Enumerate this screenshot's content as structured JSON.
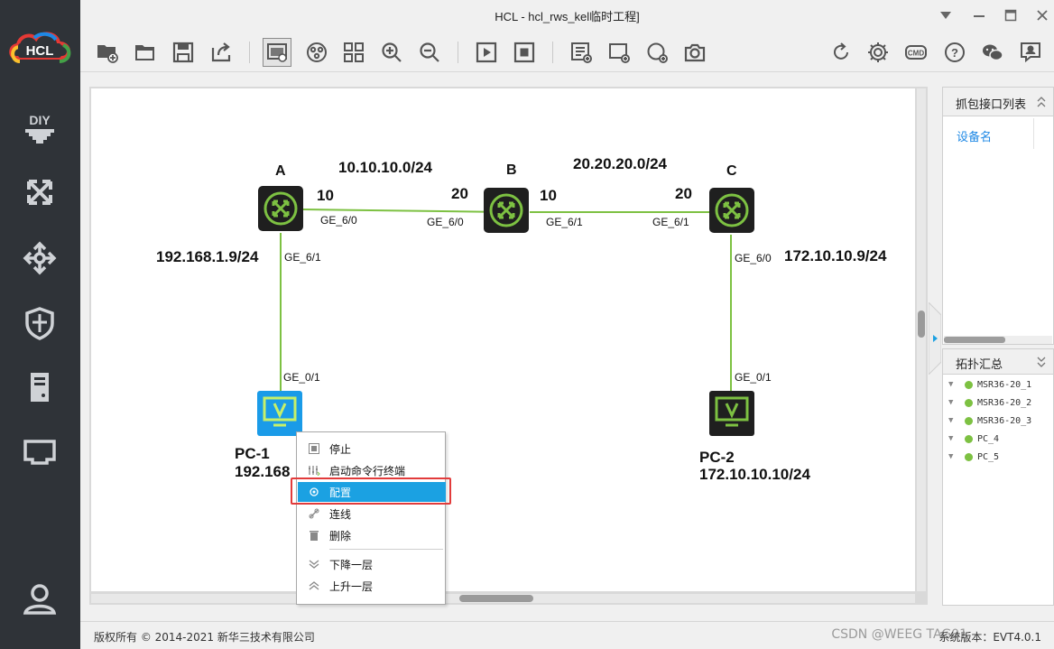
{
  "window": {
    "title": "HCL - hcl_rws_kel临时工程]"
  },
  "logo": {
    "text": "HCL"
  },
  "sidebar": [
    {
      "icon": "diy-icon"
    },
    {
      "icon": "switch-icon"
    },
    {
      "icon": "router-icon"
    },
    {
      "icon": "firewall-icon"
    },
    {
      "icon": "server-icon"
    },
    {
      "icon": "network-port-icon"
    },
    {
      "icon": "user-icon"
    }
  ],
  "topology": {
    "nodes": {
      "A": {
        "label": "A"
      },
      "B": {
        "label": "B"
      },
      "C": {
        "label": "C"
      },
      "pc1": {
        "label": "PC-1",
        "ip": "192.168"
      },
      "pc2": {
        "label": "PC-2",
        "ip": "172.10.10.10/24"
      }
    },
    "networks": {
      "ab": "10.10.10.0/24",
      "bc": "20.20.20.0/24",
      "a_pc1": "192.168.1.9/24",
      "c_pc2": "172.10.10.9/24"
    },
    "host_ids": {
      "a_east": "10",
      "b_west": "20",
      "b_east": "10",
      "c_west": "20"
    },
    "ports": {
      "a_east": "GE_6/0",
      "b_west": "GE_6/0",
      "b_east": "GE_6/1",
      "c_west": "GE_6/1",
      "a_south": "GE_6/1",
      "c_south": "GE_6/0",
      "pc1_port": "GE_0/1",
      "pc2_port": "GE_0/1"
    }
  },
  "context_menu": {
    "items": [
      {
        "label": "停止",
        "icon": "stop-icon"
      },
      {
        "label": "启动命令行终端",
        "icon": "terminal-icon"
      },
      {
        "label": "配置",
        "icon": "gear-icon",
        "selected": true
      },
      {
        "label": "连线",
        "icon": "link-icon"
      },
      {
        "label": "删除",
        "icon": "trash-icon"
      },
      {
        "label": "下降一层",
        "icon": "layer-down-icon"
      },
      {
        "label": "上升一层",
        "icon": "layer-up-icon"
      }
    ]
  },
  "capture_panel": {
    "title": "抓包接口列表",
    "column": "设备名"
  },
  "topology_summary": {
    "title": "拓扑汇总",
    "items": [
      "MSR36-20_1",
      "MSR36-20_2",
      "MSR36-20_3",
      "PC_4",
      "PC_5"
    ]
  },
  "status": {
    "copyright": "版权所有 © 2014-2021 新华三技术有限公司",
    "version": "系统版本：EVT4.0.1",
    "watermark": "CSDN @WEEG TAG01"
  },
  "colors": {
    "accent": "#1ba1e2",
    "link": "#7dc142",
    "router_bg": "#1f1f1f",
    "pc_selected": "#1a9be8",
    "highlight_border": "#e23b3b"
  }
}
